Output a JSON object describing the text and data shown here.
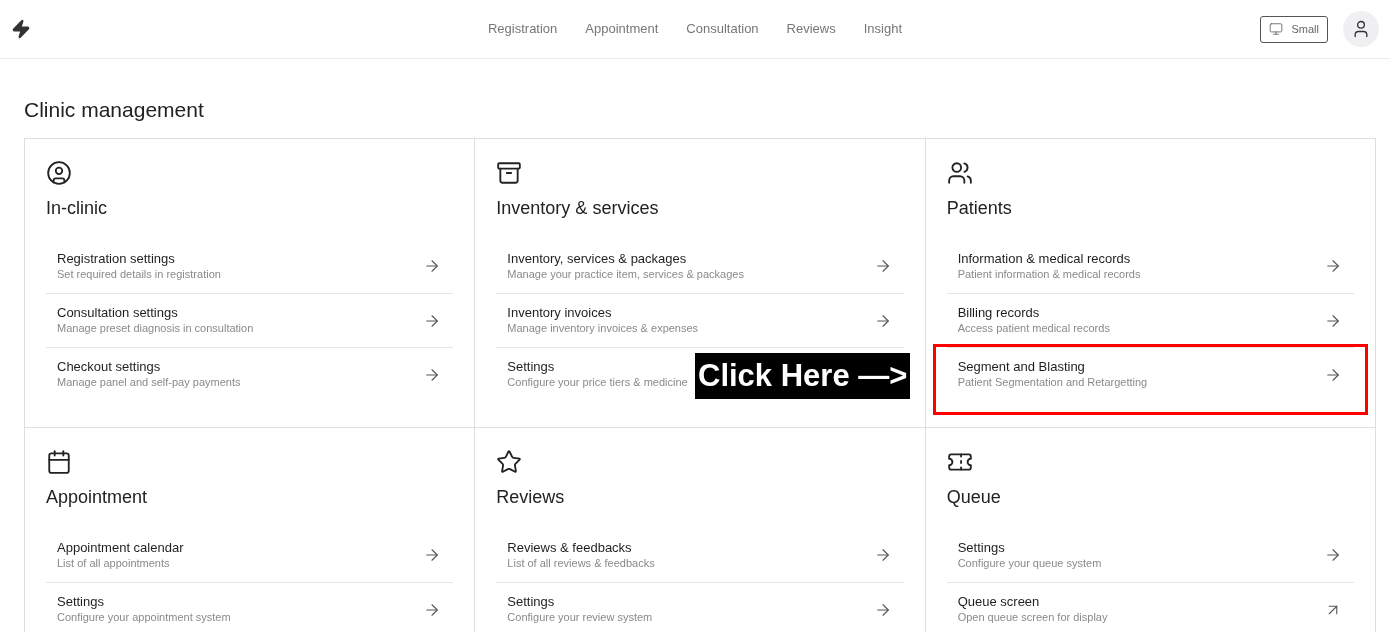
{
  "header": {
    "nav": [
      {
        "label": "Registration"
      },
      {
        "label": "Appointment"
      },
      {
        "label": "Consultation"
      },
      {
        "label": "Reviews"
      },
      {
        "label": "Insight"
      }
    ],
    "size_button": "Small"
  },
  "page_title": "Clinic management",
  "sections": [
    {
      "kind": "person-circle",
      "title": "In-clinic",
      "items": [
        {
          "title": "Registration settings",
          "subtitle": "Set required details in registration",
          "kind": "link",
          "outlined": false
        },
        {
          "title": "Consultation settings",
          "subtitle": "Manage preset diagnosis in consultation",
          "kind": "link",
          "outlined": false
        },
        {
          "title": "Checkout settings",
          "subtitle": "Manage panel and self-pay payments",
          "kind": "link",
          "outlined": false
        }
      ]
    },
    {
      "kind": "archive",
      "title": "Inventory & services",
      "items": [
        {
          "title": "Inventory, services & packages",
          "subtitle": "Manage your practice item, services & packages",
          "kind": "link",
          "outlined": false
        },
        {
          "title": "Inventory invoices",
          "subtitle": "Manage inventory invoices & expenses",
          "kind": "link",
          "outlined": false
        },
        {
          "title": "Settings",
          "subtitle": "Configure your price tiers & medicine",
          "kind": "plain",
          "outlined": false
        }
      ]
    },
    {
      "kind": "users",
      "title": "Patients",
      "items": [
        {
          "title": "Information & medical records",
          "subtitle": "Patient information & medical records",
          "kind": "link",
          "outlined": false
        },
        {
          "title": "Billing records",
          "subtitle": "Access patient medical records",
          "kind": "link",
          "outlined": false
        },
        {
          "title": "Segment and Blasting",
          "subtitle": "Patient Segmentation and Retargetting",
          "kind": "link",
          "outlined": true
        }
      ]
    },
    {
      "kind": "calendar",
      "title": "Appointment",
      "items": [
        {
          "title": "Appointment calendar",
          "subtitle": "List of all appointments",
          "kind": "link",
          "outlined": false
        },
        {
          "title": "Settings",
          "subtitle": "Configure your appointment system",
          "kind": "link",
          "outlined": false
        }
      ]
    },
    {
      "kind": "star",
      "title": "Reviews",
      "items": [
        {
          "title": "Reviews & feedbacks",
          "subtitle": "List of all reviews & feedbacks",
          "kind": "link",
          "outlined": false
        },
        {
          "title": "Settings",
          "subtitle": "Configure your review system",
          "kind": "link",
          "outlined": false
        }
      ]
    },
    {
      "kind": "ticket",
      "title": "Queue",
      "items": [
        {
          "title": "Settings",
          "subtitle": "Configure your queue system",
          "kind": "link",
          "outlined": false
        },
        {
          "title": "Queue screen",
          "subtitle": "Open queue screen for display",
          "kind": "external",
          "outlined": false
        }
      ]
    }
  ],
  "callout": {
    "text": "Click Here —>"
  }
}
